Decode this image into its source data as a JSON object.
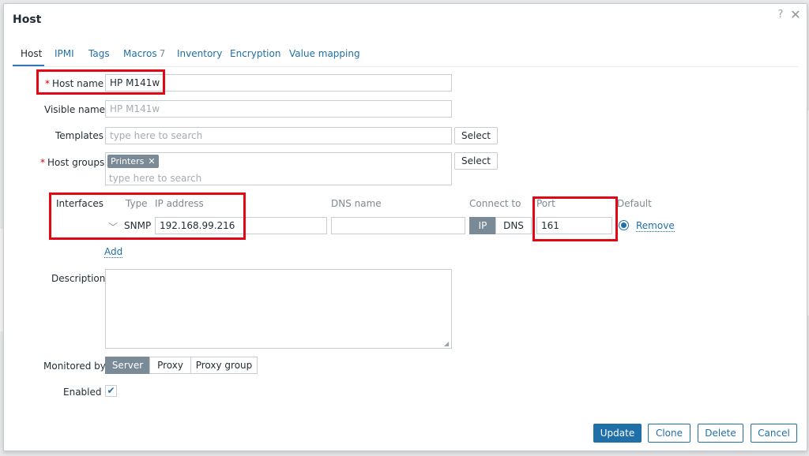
{
  "dialog": {
    "title": "Host",
    "help_icon": "?",
    "close_icon": "✕"
  },
  "tabs": [
    {
      "label": "Host",
      "active": true
    },
    {
      "label": "IPMI"
    },
    {
      "label": "Tags"
    },
    {
      "label": "Macros",
      "count": "7"
    },
    {
      "label": "Inventory"
    },
    {
      "label": "Encryption"
    },
    {
      "label": "Value mapping"
    }
  ],
  "form": {
    "host_name": {
      "label": "Host name",
      "required": "*",
      "value": "HP M141w"
    },
    "visible_name": {
      "label": "Visible name",
      "placeholder": "HP M141w"
    },
    "templates": {
      "label": "Templates",
      "placeholder": "type here to search",
      "select_label": "Select"
    },
    "host_groups": {
      "label": "Host groups",
      "required": "*",
      "tag": "Printers",
      "tag_remove": "✕",
      "placeholder": "type here to search",
      "select_label": "Select"
    },
    "interfaces": {
      "label": "Interfaces",
      "columns": {
        "type": "Type",
        "ip": "IP address",
        "dns": "DNS name",
        "connect": "Connect to",
        "port": "Port",
        "default": "Default"
      },
      "row": {
        "expand_icon": "﹀",
        "type": "SNMP",
        "ip": "192.168.99.216",
        "dns": "",
        "connect_ip": "IP",
        "connect_dns": "DNS",
        "port": "161",
        "remove_label": "Remove"
      },
      "add_label": "Add"
    },
    "description": {
      "label": "Description",
      "value": ""
    },
    "monitored_by": {
      "label": "Monitored by",
      "options": [
        "Server",
        "Proxy",
        "Proxy group"
      ],
      "selected": "Server"
    },
    "enabled": {
      "label": "Enabled",
      "checked": true,
      "check_glyph": "✔"
    }
  },
  "footer": {
    "update": "Update",
    "clone": "Clone",
    "delete": "Delete",
    "cancel": "Cancel"
  },
  "colors": {
    "accent": "#1f6fa8",
    "highlight": "#e30613",
    "required": "#d40000"
  }
}
